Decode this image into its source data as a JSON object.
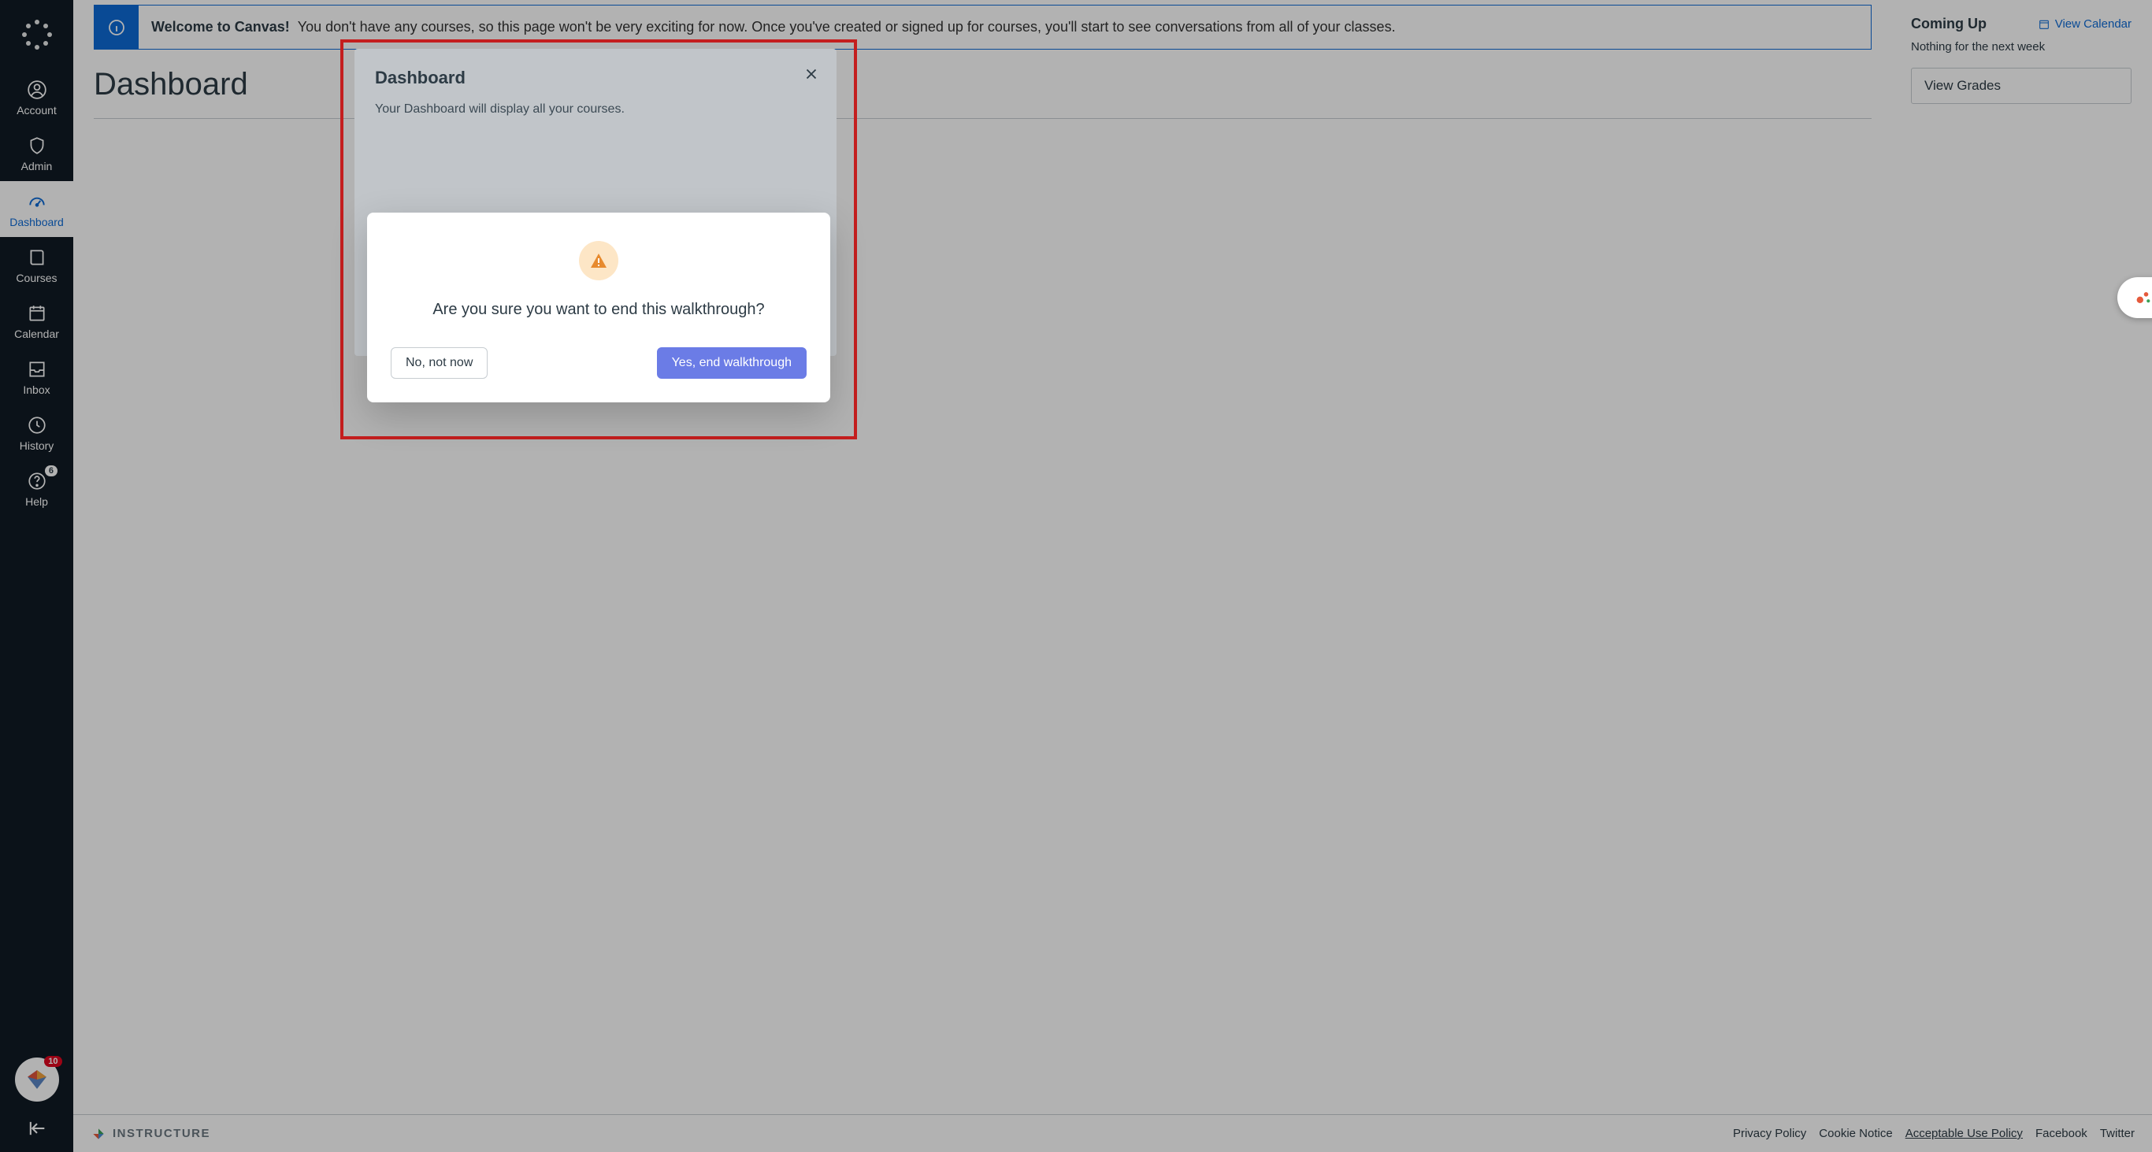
{
  "sidebar": {
    "items": [
      {
        "label": "Account"
      },
      {
        "label": "Admin"
      },
      {
        "label": "Dashboard"
      },
      {
        "label": "Courses"
      },
      {
        "label": "Calendar"
      },
      {
        "label": "Inbox"
      },
      {
        "label": "History"
      },
      {
        "label": "Help",
        "badge": "6"
      }
    ],
    "diamond_count": "10"
  },
  "banner": {
    "title": "Welcome to Canvas!",
    "body": "You don't have any courses, so this page won't be very exciting for now. Once you've created or signed up for courses, you'll start to see conversations from all of your classes."
  },
  "page": {
    "title": "Dashboard"
  },
  "aside": {
    "coming_up": "Coming Up",
    "view_calendar": "View Calendar",
    "nothing_text": "Nothing for the next week",
    "view_grades": "View Grades"
  },
  "tour": {
    "title": "Dashboard",
    "description": "Your Dashboard will display all your courses."
  },
  "confirm": {
    "question": "Are you sure you want to end this walkthrough?",
    "no_label": "No, not now",
    "yes_label": "Yes, end walkthrough"
  },
  "footer": {
    "brand": "INSTRUCTURE",
    "links": [
      "Privacy Policy",
      "Cookie Notice",
      "Acceptable Use Policy",
      "Facebook",
      "Twitter"
    ]
  }
}
